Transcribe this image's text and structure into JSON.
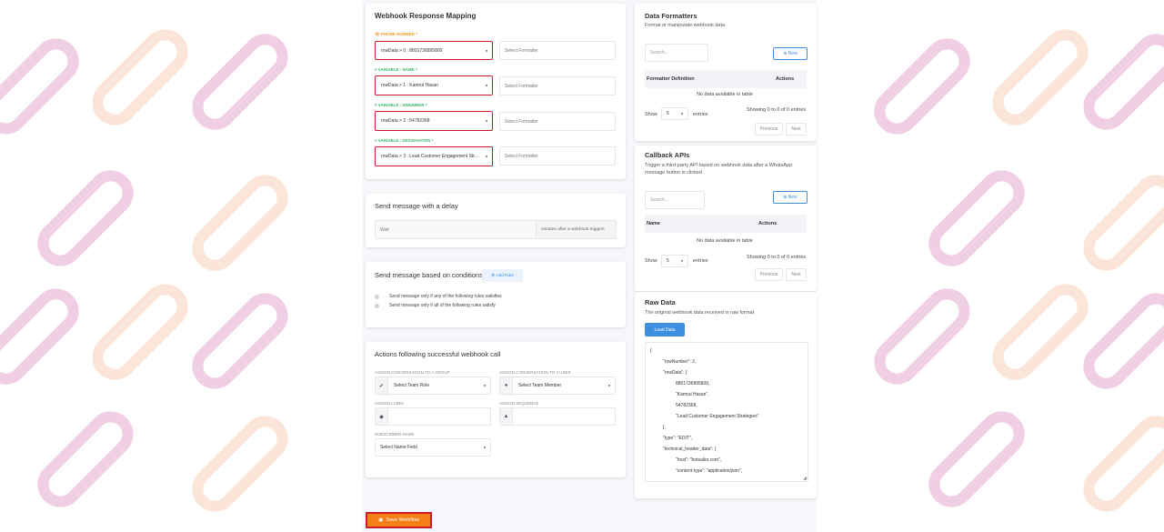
{
  "mapping": {
    "title": "Webhook Response Mapping",
    "fields": [
      {
        "label": "PHONE NUMBER *",
        "value": "rowData > 0 : 8801736895800",
        "formatter_placeholder": "Select Formatter"
      },
      {
        "label": "VARIABLE : NAME *",
        "value": "rowData > 1 : Kamrul Hasan",
        "formatter_placeholder": "Select Formatter"
      },
      {
        "label": "VARIABLE : IDNUMBER *",
        "value": "rowData > 2 : 54782368",
        "formatter_placeholder": "Select Formatter"
      },
      {
        "label": "VARIABLE : DESIGNATION *",
        "value": "rowData > 3 : Lead Customer Engagement Str...",
        "formatter_placeholder": "Select Formatter"
      }
    ]
  },
  "delay": {
    "title": "Send message with a delay",
    "wait_placeholder": "Wait",
    "suffix": "minutes after a webhook triggers"
  },
  "conditions": {
    "title": "Send message based on conditions",
    "add_rule": "Add Rule",
    "option_any": "Send message only if any of the following rules satisfies",
    "option_all": "Send message only if all of the following rules satisfy"
  },
  "actions": {
    "title": "Actions following successful webhook call",
    "group_label": "ASSIGN CONVERSATION TO A GROUP",
    "group_value": "Select Team Role",
    "user_label": "ASSIGN CONVERSATION TO A USER",
    "user_value": "Select Team Member",
    "label_label": "ASSIGN LABEL",
    "sequence_label": "ASSIGN SEQUENCE",
    "subscriber_label": "SUBSCRIBER NAME",
    "subscriber_value": "Select Name Field"
  },
  "save_button": "Save Workflow",
  "formatters": {
    "title": "Data Formatters",
    "subtitle": "Format or manipulate webhook data",
    "search_placeholder": "Search...",
    "new_button": "New",
    "col1": "Formatter Definition",
    "col2": "Actions",
    "empty": "No data available in table",
    "show": "Show",
    "entries_value": "5",
    "entries": "entries",
    "summary": "Showing 0 to 0 of 0 entries",
    "previous": "Previous",
    "next": "Next"
  },
  "callbacks": {
    "title": "Callback APIs",
    "subtitle": "Trigger a third-party API based on webhook data after a WhatsApp message button is clicked",
    "search_placeholder": "Search...",
    "new_button": "New",
    "col1": "Name",
    "col2": "Actions",
    "empty": "No data available in table",
    "show": "Show",
    "entries_value": "5",
    "entries": "entries",
    "summary": "Showing 0 to 0 of 0 entries",
    "previous": "Previous",
    "next": "Next"
  },
  "raw": {
    "title": "Raw Data",
    "subtitle": "The original webhook data received in raw format",
    "load_button": "Load Data",
    "lines": [
      "{",
      "\"rowNumber\": 2,",
      "\"rowData\": [",
      "8801736895800,",
      "\"Kamrul Hasan\",",
      "54782368,",
      "\"Lead Customer Engagement Strategies\"",
      "],",
      "\"type\": \"EDIT\",",
      "\"technical_header_data\": {",
      "\"host\": \"botsailor.com\",",
      "\"content-type\": \"application/json\","
    ]
  },
  "colors": {
    "accent": "#3d8fe0",
    "error_border": "#d01c2a",
    "save": "#f57f17",
    "label_orange": "#f59a23",
    "label_green": "#3cb371"
  }
}
